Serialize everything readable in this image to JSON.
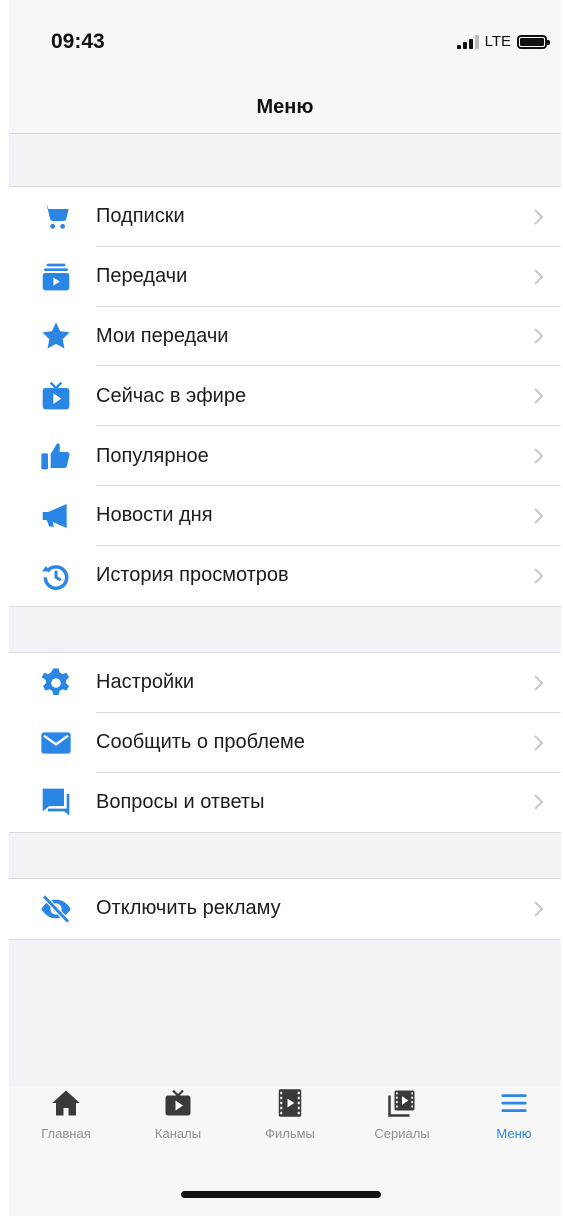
{
  "status_bar": {
    "time": "09:43",
    "network": "LTE"
  },
  "nav": {
    "title": "Меню"
  },
  "colors": {
    "accent": "#2a86e4",
    "chevron": "#c7c7cc",
    "inactive_tab": "#3a3a3c"
  },
  "groups": [
    {
      "items": [
        {
          "label": "Подписки",
          "icon": "cart-icon"
        },
        {
          "label": "Передачи",
          "icon": "playlist-icon"
        },
        {
          "label": "Мои передачи",
          "icon": "star-icon"
        },
        {
          "label": "Сейчас в эфире",
          "icon": "tv-icon"
        },
        {
          "label": "Популярное",
          "icon": "thumbs-up-icon"
        },
        {
          "label": "Новости дня",
          "icon": "megaphone-icon"
        },
        {
          "label": "История просмотров",
          "icon": "history-icon"
        }
      ]
    },
    {
      "items": [
        {
          "label": "Настройки",
          "icon": "gear-icon"
        },
        {
          "label": "Сообщить о проблеме",
          "icon": "envelope-icon"
        },
        {
          "label": "Вопросы и ответы",
          "icon": "chat-icon"
        }
      ]
    },
    {
      "items": [
        {
          "label": "Отключить рекламу",
          "icon": "eye-off-icon"
        }
      ]
    }
  ],
  "tabs": [
    {
      "label": "Главная",
      "icon": "home-icon",
      "active": false
    },
    {
      "label": "Каналы",
      "icon": "tv-icon",
      "active": false
    },
    {
      "label": "Фильмы",
      "icon": "film-icon",
      "active": false
    },
    {
      "label": "Сериалы",
      "icon": "series-icon",
      "active": false
    },
    {
      "label": "Меню",
      "icon": "menu-icon",
      "active": true
    }
  ]
}
